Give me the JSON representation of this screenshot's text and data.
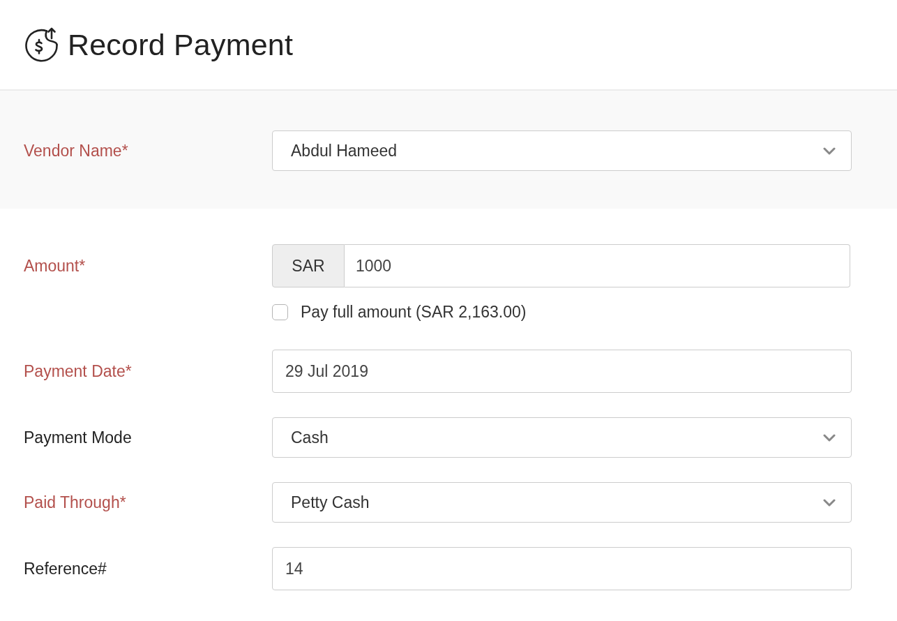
{
  "header": {
    "title": "Record Payment"
  },
  "sections": [
    {
      "highlighted": true,
      "fields": [
        {
          "kind": "select",
          "label": "Vendor Name*",
          "required": true,
          "value": "Abdul Hameed"
        }
      ]
    },
    {
      "highlighted": false,
      "fields": [
        {
          "kind": "currency",
          "label": "Amount*",
          "required": true,
          "prefix": "SAR",
          "value": "1000",
          "option": {
            "label": "Pay full amount (SAR 2,163.00)",
            "checked": false
          }
        },
        {
          "kind": "text",
          "label": "Payment Date*",
          "required": true,
          "value": "29 Jul 2019"
        },
        {
          "kind": "select",
          "label": "Payment Mode",
          "required": false,
          "value": "Cash"
        },
        {
          "kind": "select",
          "label": "Paid Through*",
          "required": true,
          "value": "Petty Cash"
        },
        {
          "kind": "text",
          "label": "Reference#",
          "required": false,
          "value": "14"
        }
      ]
    }
  ]
}
